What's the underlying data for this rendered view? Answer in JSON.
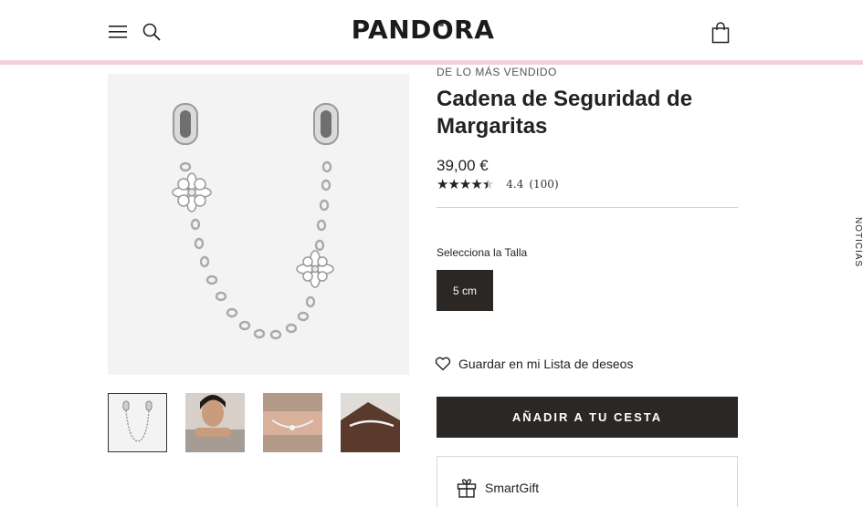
{
  "header": {
    "brand": "PANDORA",
    "menu_icon": "hamburger-menu-icon",
    "search_icon": "search-icon",
    "bag_icon": "shopping-bag-icon",
    "accent_line_color": "#f6d0d8"
  },
  "gallery": {
    "main_image": "daisy-safety-chain-charm",
    "thumbnails": [
      {
        "name": "daisy-safety-chain-charm"
      },
      {
        "name": "woman-wearing-bracelet"
      },
      {
        "name": "bracelet-on-wrist"
      },
      {
        "name": "bracelet-on-wrist-closeup"
      }
    ],
    "selected_index": 0
  },
  "product": {
    "eyebrow": "DE LO MÁS VENDIDO",
    "title": "Cadena de Seguridad de Margaritas",
    "price": "39,00 €",
    "rating_value": "4.4",
    "rating_count": "(100)",
    "stars": 4.4
  },
  "size": {
    "label": "Selecciona la Talla",
    "selected": "5 cm"
  },
  "actions": {
    "wishlist_label": "Guardar en mi Lista de deseos",
    "wishlist_icon": "heart-icon",
    "add_to_cart": "AÑADIR A TU CESTA",
    "button_color": "#2a2724"
  },
  "smartgift": {
    "label": "SmartGift",
    "icon": "gift-icon"
  },
  "side_tab": {
    "label": "NOTICIAS"
  }
}
